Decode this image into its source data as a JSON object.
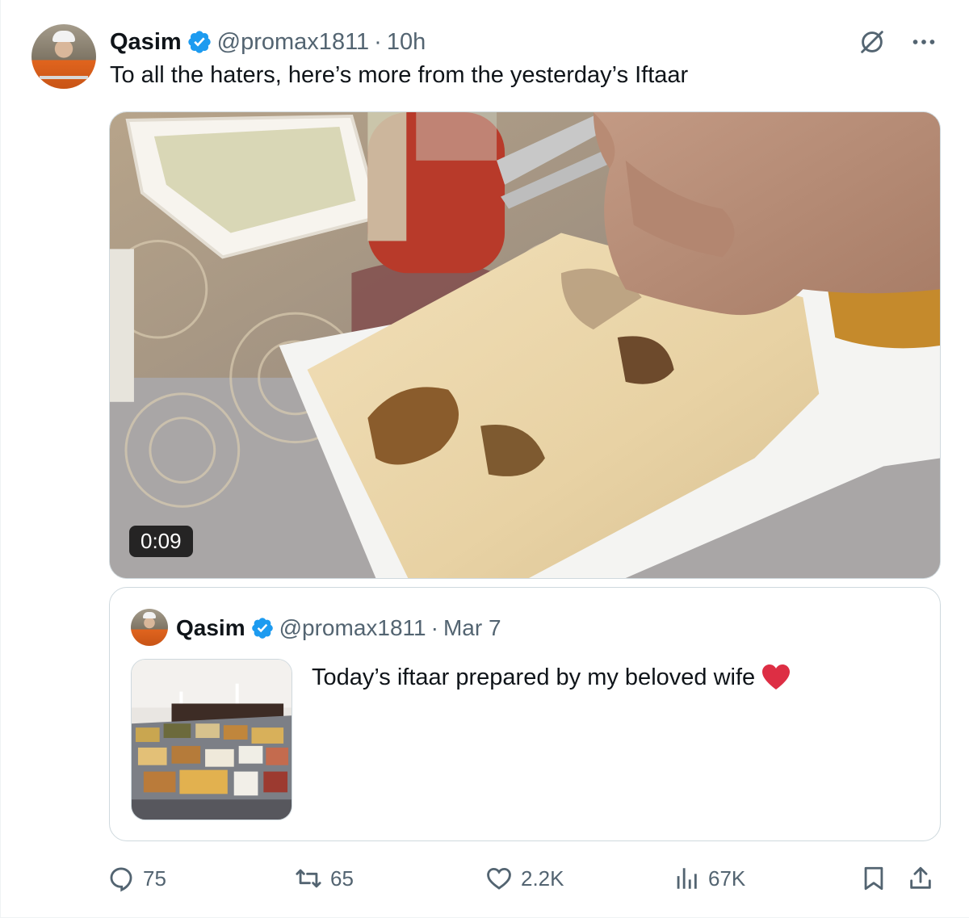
{
  "post": {
    "author_name": "Qasim",
    "handle": "@promax1811",
    "separator": "·",
    "time": "10h",
    "text": "To all the haters, here’s more from the yesterday’s Iftaar",
    "video_duration": "0:09"
  },
  "quoted": {
    "author_name": "Qasim",
    "handle": "@promax1811",
    "separator": "·",
    "date": "Mar 7",
    "text": "Today’s iftaar prepared by my beloved wife"
  },
  "actions": {
    "replies": "75",
    "reposts": "65",
    "likes": "2.2K",
    "views": "67K"
  },
  "colors": {
    "verified": "#1d9bf0",
    "muted_text": "#536471",
    "border": "#cfd9de",
    "heart_emoji": "#dd2e44"
  },
  "icons": [
    "grok-icon",
    "more-icon",
    "verified-icon",
    "reply-icon",
    "repost-icon",
    "like-icon",
    "views-icon",
    "bookmark-icon",
    "share-icon"
  ]
}
